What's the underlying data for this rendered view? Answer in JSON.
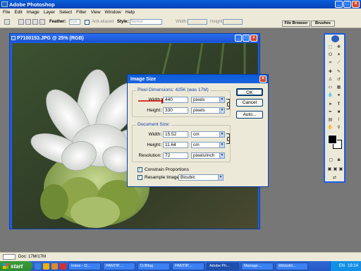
{
  "app": {
    "title": "Adobe Photoshop"
  },
  "menu": [
    "File",
    "Edit",
    "Image",
    "Layer",
    "Select",
    "Filter",
    "View",
    "Window",
    "Help"
  ],
  "options": {
    "feather_label": "Feather:",
    "feather_value": "0 px",
    "antialiased_label": "Anti-aliased",
    "style_label": "Style:",
    "style_value": "Normal",
    "width_label": "Width:",
    "height_label": "Height:"
  },
  "palette_tabs": {
    "file_browser": "File Browser",
    "brushes": "Brushes"
  },
  "document": {
    "title": "P7100153.JPG @ 25% (RGB)"
  },
  "dialog": {
    "title": "Image Size",
    "pixel_dimensions": {
      "label": "Pixel Dimensions: 425K (was 17M)",
      "width_label": "Width:",
      "width_value": "440",
      "width_unit": "pixels",
      "height_label": "Height:",
      "height_value": "330",
      "height_unit": "pixels"
    },
    "document_size": {
      "label": "Document Size:",
      "width_label": "Width:",
      "width_value": "15.52",
      "width_unit": "cm",
      "height_label": "Height:",
      "height_value": "11.64",
      "height_unit": "cm",
      "resolution_label": "Resolution:",
      "resolution_value": "72",
      "resolution_unit": "pixels/inch"
    },
    "constrain_label": "Constrain Proportions",
    "resample_label": "Resample Image:",
    "resample_value": "Bicubic",
    "buttons": {
      "ok": "OK",
      "cancel": "Cancel",
      "auto": "Auto..."
    }
  },
  "status": {
    "doc": "Doc: 17M/17M"
  },
  "taskbar": {
    "start": "start",
    "items": [
      "Inbox - O...",
      "PANTIP....",
      "D:/Blog",
      "PANTIP....",
      "Adobe Ph...",
      "Manage ...",
      "สอนแต่ง..."
    ],
    "lang": "EN",
    "clock": "19:14"
  },
  "colors": {
    "xp_blue": "#0a5ddb",
    "dialog_bg": "#ece9d8",
    "start_green": "#3c9b3c",
    "red_arrow": "#cc0000"
  }
}
